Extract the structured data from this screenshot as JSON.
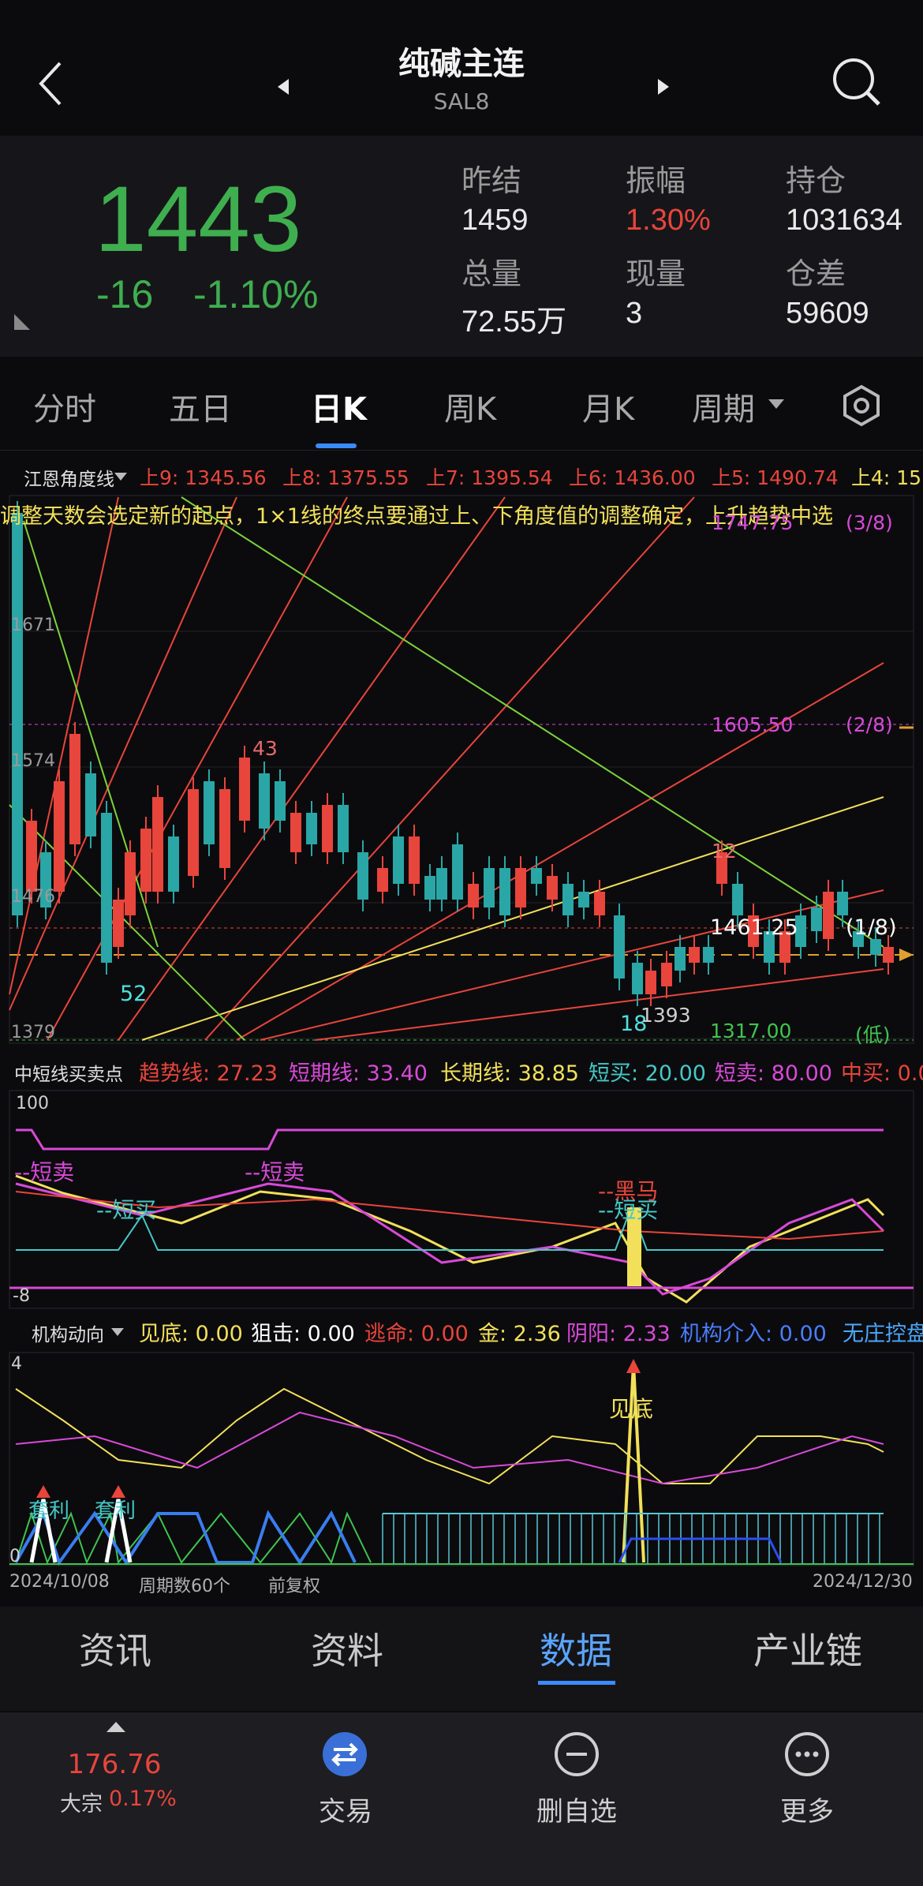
{
  "header": {
    "title": "纯碱主连",
    "code": "SAL8"
  },
  "quote": {
    "price": "1443",
    "change": "-16",
    "change_pct": "-1.10%",
    "fields": [
      {
        "label": "昨结",
        "value": "1459",
        "color": "#eaeaea"
      },
      {
        "label": "振幅",
        "value": "1.30%",
        "color": "#e8453c"
      },
      {
        "label": "持仓",
        "value": "1031634",
        "color": "#eaeaea"
      },
      {
        "label": "总量",
        "value": "72.55万",
        "color": "#eaeaea"
      },
      {
        "label": "现量",
        "value": "3",
        "color": "#eaeaea"
      },
      {
        "label": "仓差",
        "value": "59609",
        "color": "#eaeaea"
      }
    ]
  },
  "tabs": [
    {
      "label": "分时"
    },
    {
      "label": "五日"
    },
    {
      "label": "日K"
    },
    {
      "label": "周K"
    },
    {
      "label": "月K"
    },
    {
      "label": "周期"
    }
  ],
  "gann": {
    "name": "江恩角度线",
    "levels": [
      {
        "text": "上9: 1345.56",
        "color": "#e8453c"
      },
      {
        "text": "上8: 1375.55",
        "color": "#e8453c"
      },
      {
        "text": "上7: 1395.54",
        "color": "#e8453c"
      },
      {
        "text": "上6: 1436.00",
        "color": "#e8453c"
      },
      {
        "text": "上5: 1490.74",
        "color": "#e8453c"
      },
      {
        "text": "上4: 15",
        "color": "#f2e05a"
      }
    ],
    "scroll_text": "调整天数会选定新的起点，1×1线的终点要通过上、下角度值的调整确定，上升趋势中选"
  },
  "main_chart": {
    "y_ticks": [
      "1671",
      "1574",
      "1476",
      "1379"
    ],
    "levels": [
      {
        "value": "1747.75",
        "tag": "(3/8)",
        "color": "#d84ad8"
      },
      {
        "value": "1605.50",
        "tag": "(2/8)",
        "color": "#d84ad8"
      },
      {
        "value": "1461.25",
        "tag": "(1/8)",
        "color": "#ffffff"
      },
      {
        "value": "1317.00",
        "tag": "(低)",
        "color": "#3fc44f"
      }
    ],
    "marks": [
      "43",
      "52",
      "18",
      "12",
      "1393"
    ]
  },
  "indicator1": {
    "name": "中短线买卖点",
    "values": [
      {
        "text": "趋势线: 27.23",
        "color": "#e8453c"
      },
      {
        "text": "短期线: 33.40",
        "color": "#d84ad8"
      },
      {
        "text": "长期线: 38.85",
        "color": "#f2e05a"
      },
      {
        "text": "短买: 20.00",
        "color": "#45c8c8"
      },
      {
        "text": "短卖: 80.00",
        "color": "#d84ad8"
      },
      {
        "text": "中买: 0.0",
        "color": "#e8453c"
      }
    ],
    "y_top": "100",
    "y_bottom": "-8",
    "annotations": [
      "--短卖",
      "--短卖",
      "--短买",
      "--黑马",
      "--短买"
    ]
  },
  "indicator2": {
    "name": "机构动向",
    "values": [
      {
        "text": "见底: 0.00",
        "color": "#f2e05a"
      },
      {
        "text": "狙击: 0.00",
        "color": "#ffffff"
      },
      {
        "text": "逃命: 0.00",
        "color": "#e8453c"
      },
      {
        "text": "金: 2.36",
        "color": "#f2e05a"
      },
      {
        "text": "阴阳: 2.33",
        "color": "#d84ad8"
      },
      {
        "text": "机构介入: 0.00",
        "color": "#4a7dff"
      },
      {
        "text": "无庄控盘",
        "color": "#4aa8ff"
      }
    ],
    "y_top": "4",
    "y_bottom": "0",
    "annotations": [
      "见底",
      "套利",
      "套利"
    ]
  },
  "date_bar": {
    "start": "2024/10/08",
    "period": "周期数60个",
    "adjust": "前复权",
    "end": "2024/12/30"
  },
  "bottom_tabs": [
    {
      "label": "资讯"
    },
    {
      "label": "资料"
    },
    {
      "label": "数据"
    },
    {
      "label": "产业链"
    }
  ],
  "footer": {
    "ticker_value": "176.76",
    "ticker_name": "大宗",
    "ticker_pct": "0.17%",
    "items": [
      {
        "label": "交易"
      },
      {
        "label": "删自选"
      },
      {
        "label": "更多"
      }
    ]
  }
}
